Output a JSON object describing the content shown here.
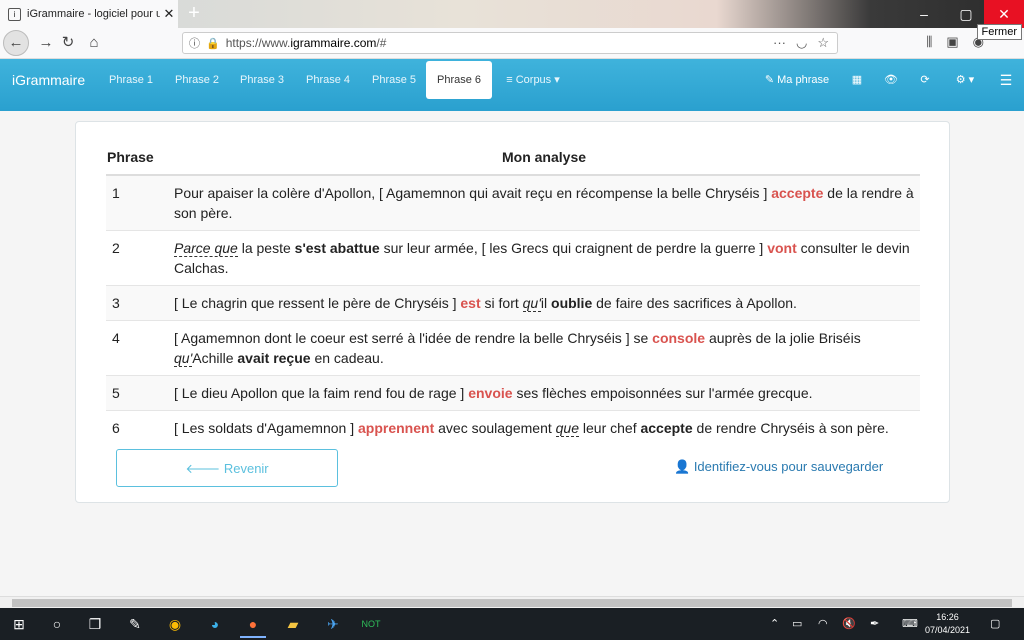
{
  "browser": {
    "tab_title": "iGrammaire - logiciel pour un",
    "url_prefix": "https://www.",
    "url_host": "igrammaire.com",
    "url_suffix": "/#",
    "tooltip": "Fermer"
  },
  "appnav": {
    "brand": "iGrammaire",
    "tabs": [
      "Phrase 1",
      "Phrase 2",
      "Phrase 3",
      "Phrase 4",
      "Phrase 5",
      "Phrase 6"
    ],
    "active_tab": "Phrase 6",
    "corpus": "Corpus",
    "ma_phrase": "Ma phrase"
  },
  "table": {
    "col1": "Phrase",
    "col2": "Mon analyse",
    "rows": [
      {
        "num": "1",
        "segments": [
          [
            "Pour apaiser la colère d'Apollon, [ Agamemnon qui avait reçu en récompense la belle Chryséis ] ",
            ""
          ],
          [
            "accepte",
            "v"
          ],
          [
            " de la rendre à son père.",
            ""
          ]
        ]
      },
      {
        "num": "2",
        "segments": [
          [
            "Parce que",
            "i"
          ],
          [
            " la peste ",
            ""
          ],
          [
            "s'est abattue",
            "b"
          ],
          [
            " sur leur armée, [ les Grecs qui craignent de perdre la guerre ] ",
            ""
          ],
          [
            "vont",
            "v"
          ],
          [
            " consulter le devin Calchas.",
            ""
          ]
        ]
      },
      {
        "num": "3",
        "segments": [
          [
            "[ Le chagrin que ressent le père de Chryséis ] ",
            ""
          ],
          [
            "est",
            "v"
          ],
          [
            " si fort ",
            ""
          ],
          [
            "qu'",
            "i"
          ],
          [
            "il ",
            ""
          ],
          [
            "oublie",
            "b"
          ],
          [
            " de faire des sacrifices à Apollon.",
            ""
          ]
        ]
      },
      {
        "num": "4",
        "segments": [
          [
            "[ Agamemnon dont le coeur est serré à l'idée de rendre la belle Chryséis ] se ",
            ""
          ],
          [
            "console",
            "v"
          ],
          [
            " auprès de la jolie Briséis ",
            ""
          ],
          [
            "qu'",
            "i"
          ],
          [
            "Achille ",
            ""
          ],
          [
            "avait reçue",
            "b"
          ],
          [
            " en cadeau.",
            ""
          ]
        ]
      },
      {
        "num": "5",
        "segments": [
          [
            "[ Le dieu Apollon que la faim rend fou de rage ] ",
            ""
          ],
          [
            "envoie",
            "v"
          ],
          [
            " ses flèches empoisonnées sur l'armée grecque.",
            ""
          ]
        ]
      },
      {
        "num": "6",
        "segments": [
          [
            "[ Les soldats d'Agamemnon ] ",
            ""
          ],
          [
            "apprennent",
            "v"
          ],
          [
            " avec soulagement ",
            ""
          ],
          [
            "que",
            "i"
          ],
          [
            " leur chef ",
            ""
          ],
          [
            "accepte",
            "b"
          ],
          [
            " de rendre Chryséis à son père.",
            ""
          ]
        ]
      }
    ]
  },
  "actions": {
    "back": "Revenir",
    "login": "Identifiez-vous pour sauvegarder"
  },
  "taskbar": {
    "time": "16:26",
    "date": "07/04/2021"
  },
  "colors": {
    "nav": "#2aa0cf",
    "verb_red": "#d9534f",
    "link": "#2a7ab0"
  }
}
